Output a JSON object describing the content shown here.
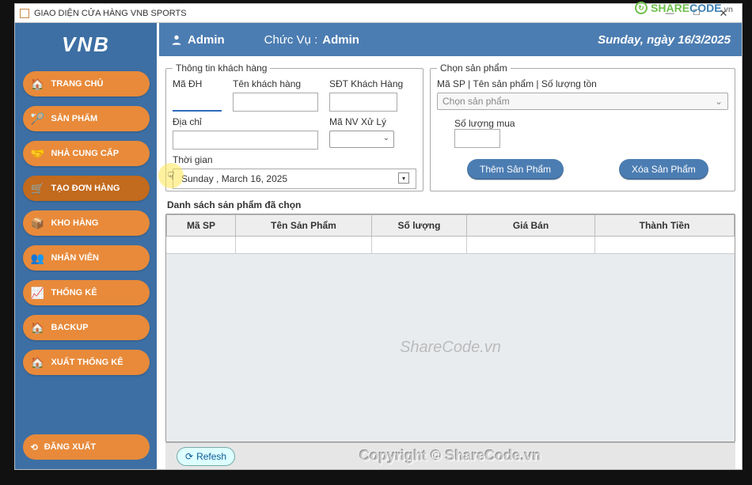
{
  "window": {
    "title": "GIAO DIỆN CỬA HÀNG VNB SPORTS"
  },
  "watermark": {
    "p1": "SHARE",
    "p2": "CODE",
    "p3": ".vn"
  },
  "sidebar": {
    "brand": "VNB",
    "items": [
      {
        "label": "TRANG CHỦ"
      },
      {
        "label": "SẢN PHẨM"
      },
      {
        "label": "NHÀ CUNG CẤP"
      },
      {
        "label": "TẠO ĐƠN HÀNG"
      },
      {
        "label": "KHO HÀNG"
      },
      {
        "label": "NHÂN VIÊN"
      },
      {
        "label": "THỐNG KÊ"
      },
      {
        "label": "BACKUP"
      },
      {
        "label": "XUẤT THỐNG KÊ"
      }
    ],
    "logout": "ĐĂNG XUẤT"
  },
  "topbar": {
    "user": "Admin",
    "role_label": "Chức Vụ :",
    "role_value": "Admin",
    "date": "Sunday, ngày 16/3/2025"
  },
  "form": {
    "customer": {
      "legend": "Thông tin khách hàng",
      "order_id": "Mã ĐH",
      "name": "Tên khách hàng",
      "phone": "SĐT Khách Hàng",
      "address": "Địa chỉ",
      "staff": "Mã NV Xử Lý",
      "time": "Thời gian",
      "time_value": "Sunday   ,   March   16, 2025"
    },
    "product": {
      "legend": "Chọn sản phẩm",
      "filter_label": "Mã SP | Tên sản phẩm | Số lượng tồn",
      "placeholder": "Chọn sản phẩm",
      "qty_label": "Số lượng mua",
      "add_btn": "Thêm Sản Phẩm",
      "del_btn": "Xóa Sản Phẩm"
    }
  },
  "grid": {
    "title": "Danh sách sản phẩm đã chọn",
    "cols": [
      "Mã SP",
      "Tên Sản Phẩm",
      "Số lượng",
      "Giá Bán",
      "Thành Tiền"
    ],
    "watermark": "ShareCode.vn"
  },
  "bottom": {
    "refresh": "Refesh",
    "copyright": "Copyright © ShareCode.vn"
  }
}
